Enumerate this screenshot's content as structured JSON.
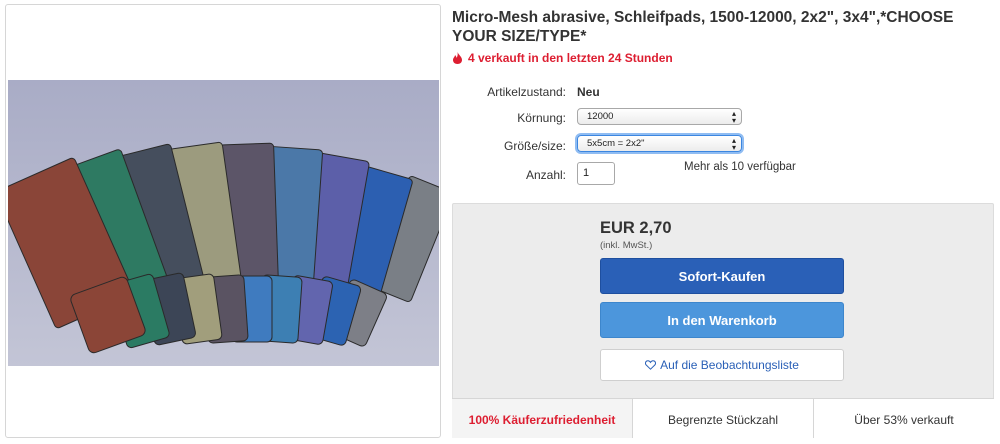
{
  "product": {
    "title": "Micro-Mesh abrasive, Schleifpads, 1500-12000, 2x2\", 3x4\",*CHOOSE YOUR SIZE/TYPE*",
    "urgency_text": "4 verkauft in den letzten 24 Stunden",
    "urgency_icon": "flame-icon"
  },
  "details": {
    "condition_label": "Artikelzustand:",
    "condition_value": "Neu",
    "grit_label": "Körnung:",
    "grit_value": "12000",
    "size_label": "Größe/size:",
    "size_value": "5x5cm = 2x2\"",
    "quantity_label": "Anzahl:",
    "quantity_value": "1",
    "availability": "Mehr als 10 verfügbar"
  },
  "purchase": {
    "price": "EUR 2,70",
    "price_note": "(inkl. MwSt.)",
    "buy_now": "Sofort-Kaufen",
    "add_to_cart": "In den Warenkorb",
    "watchlist": "Auf die Beobachtungsliste",
    "watchlist_icon": "heart-icon"
  },
  "stats": [
    "100% Käuferzufriedenheit",
    "Begrenzte Stückzahl",
    "Über 53% verkauft"
  ],
  "colors": {
    "accent_blue": "#2a60b7",
    "cart_blue": "#4c96dc",
    "alert_red": "#dd1e31"
  }
}
